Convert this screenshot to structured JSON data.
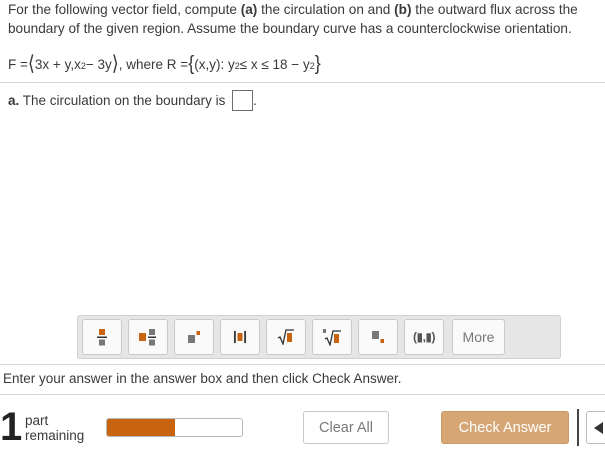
{
  "problem": {
    "line1_a": "For the following vector field, compute ",
    "line1_b": "(a)",
    "line1_c": " the circulation on and ",
    "line1_d": "(b)",
    "line1_e": " the outward flux across the",
    "line2": "boundary of the given region. Assume the boundary curve has a counterclockwise orientation."
  },
  "formula": {
    "f_label": "F = ",
    "lbrack": "⟨",
    "comp1": "3x + y,x",
    "exp1": "2",
    "comp2": " − 3y",
    "rbrack": "⟩",
    "where": ", where R = ",
    "lbrace": "{",
    "set1": "(x,y): y",
    "exp2": "2",
    "set2": " ≤ x ≤ 18 − y",
    "exp3": "2",
    "rbrace": "}"
  },
  "part_a": {
    "label": "a.",
    "text": " The circulation on the boundary is ",
    "answer_value": "",
    "after": "."
  },
  "toolbar": {
    "buttons": [
      "fraction-icon",
      "mixed-number-icon",
      "exponent-icon",
      "absolute-value-icon",
      "square-root-icon",
      "nth-root-icon",
      "subscript-icon",
      "interval-icon"
    ],
    "interval_label": "(▮,▮)",
    "more_label": "More"
  },
  "instruction": "Enter your answer in the answer box and then click Check Answer.",
  "footer": {
    "parts_count": "1",
    "part_word": "part",
    "remaining_word": "remaining",
    "progress_fraction": 0.5,
    "progress_color": "#c8640f",
    "clear_label": "Clear All",
    "check_label": "Check Answer",
    "check_color": "#d6a675"
  }
}
